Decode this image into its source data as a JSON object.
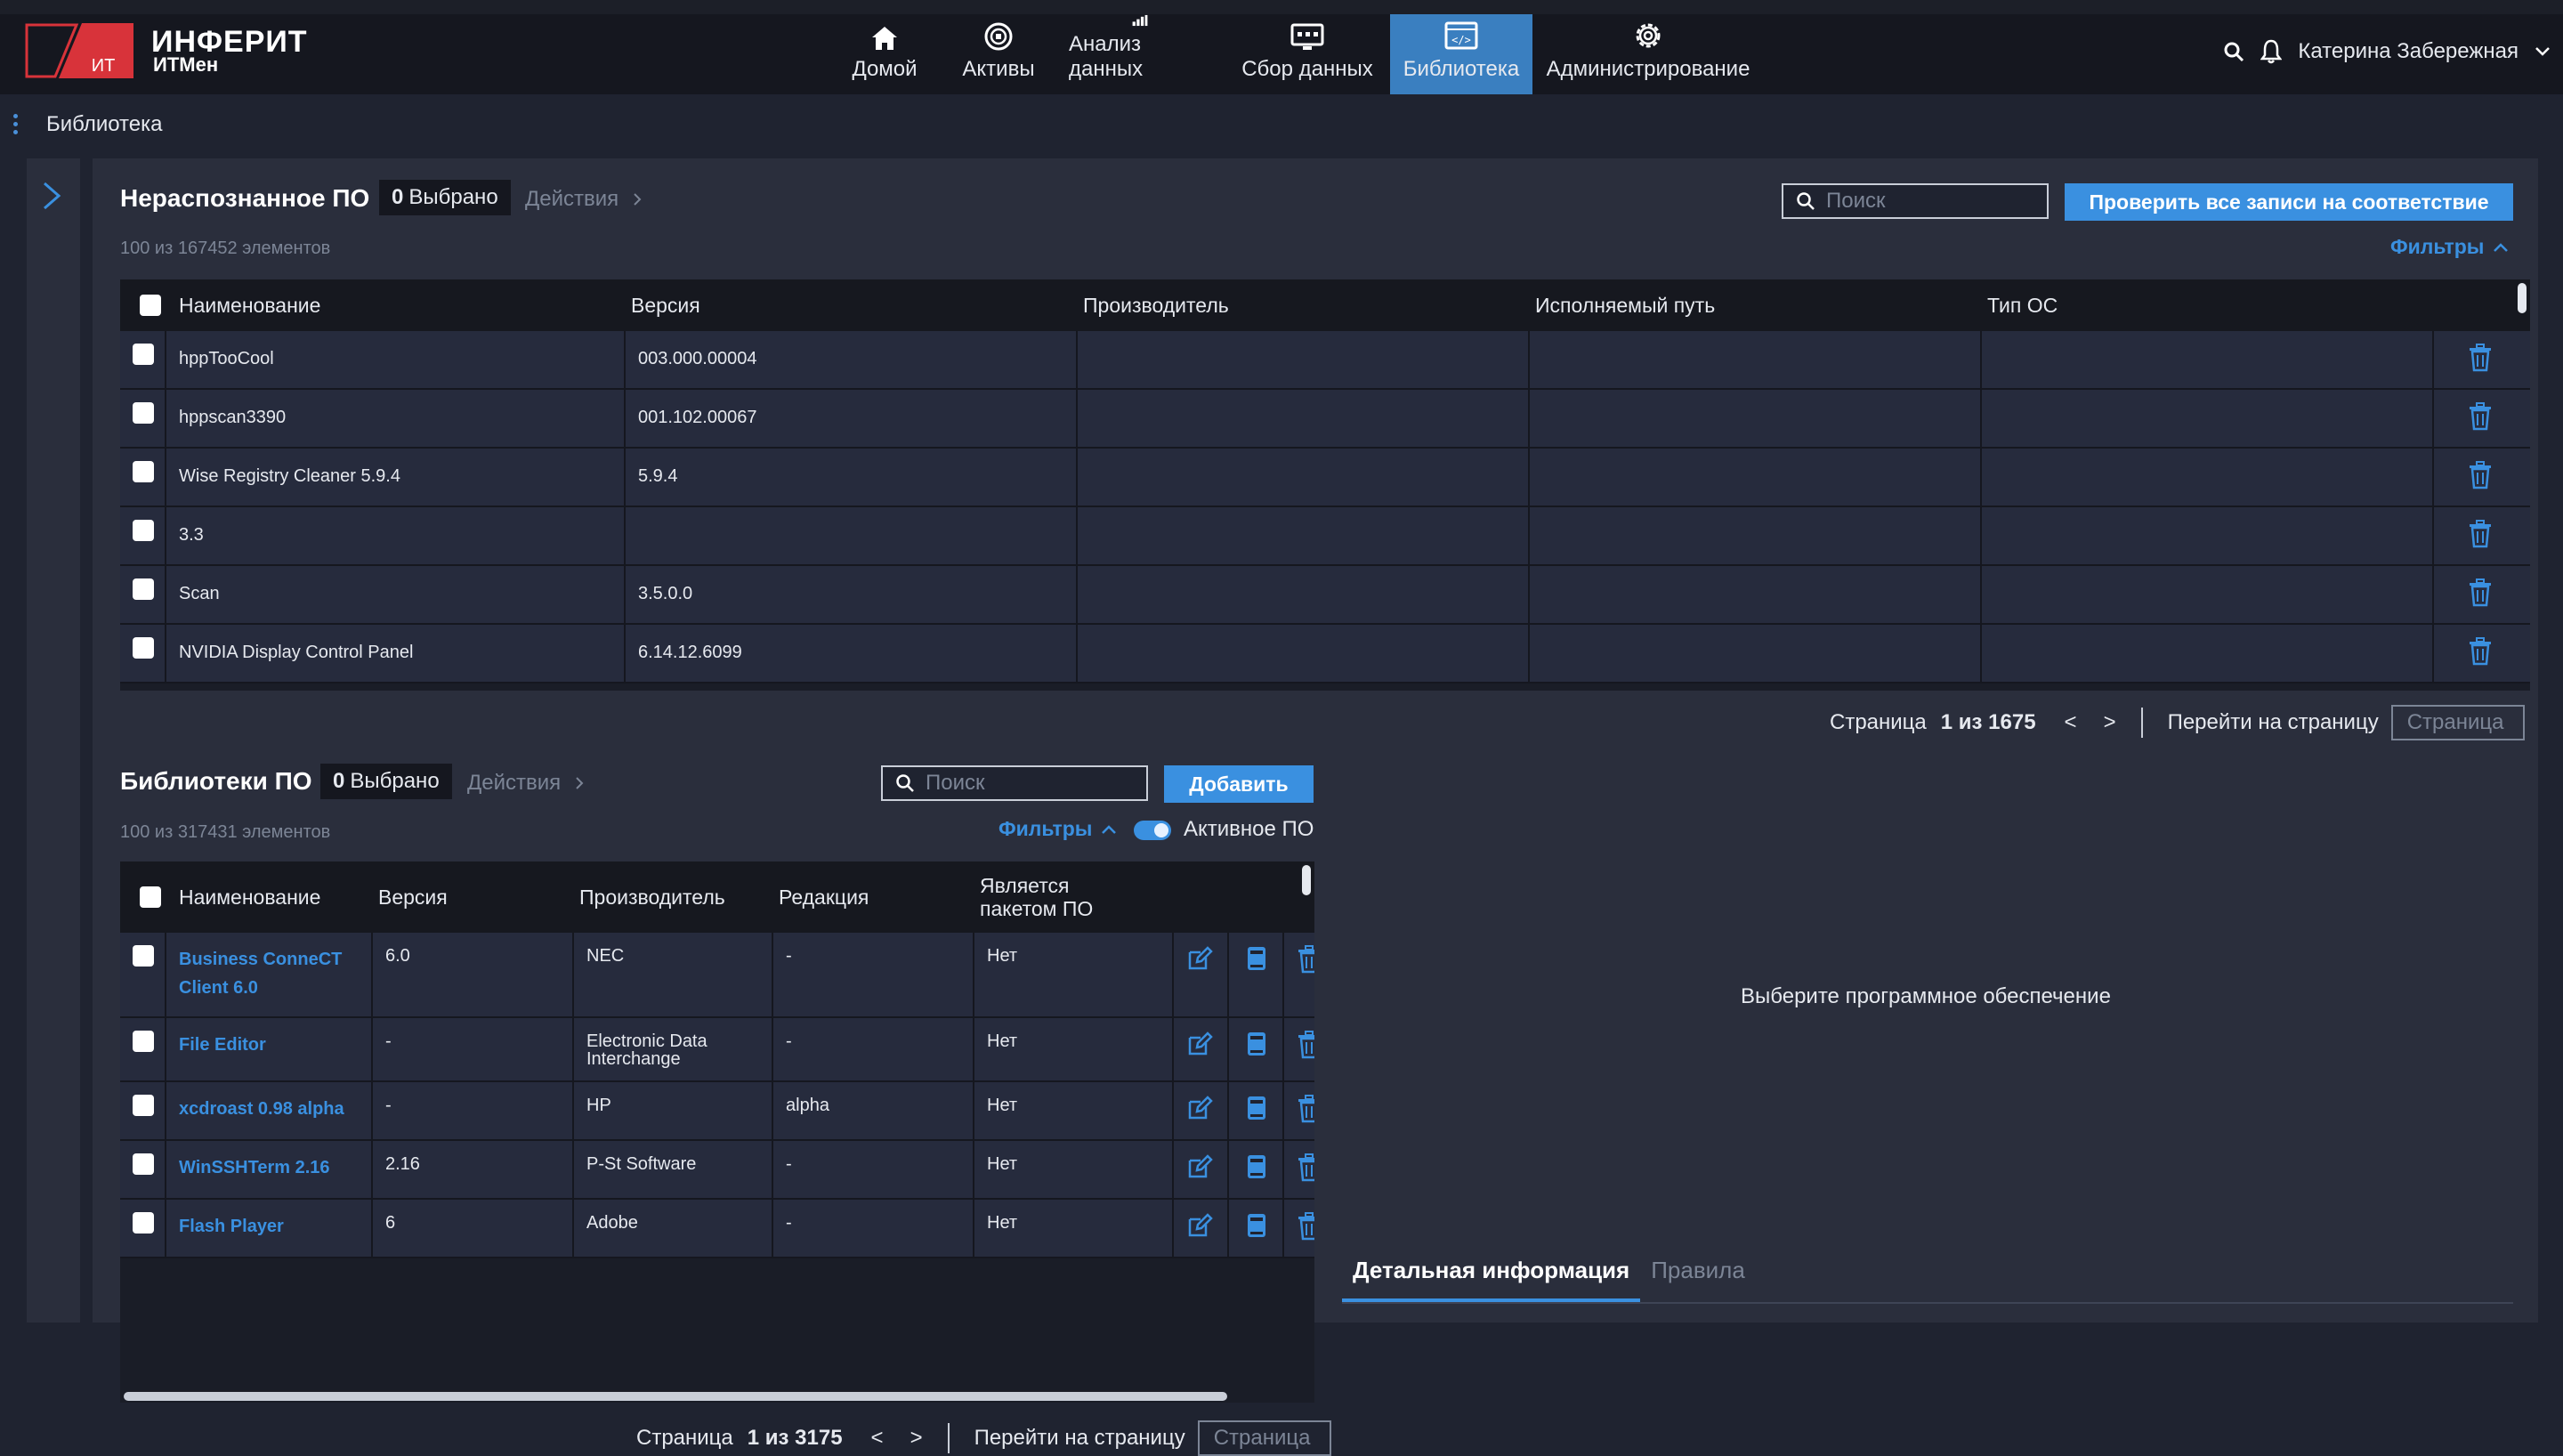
{
  "brand": {
    "name": "ИНФЕРИТ",
    "sub": "ИТМен",
    "logo_text": "ИТ"
  },
  "nav": [
    {
      "label": "Домой",
      "icon": "home-icon"
    },
    {
      "label": "Активы",
      "icon": "assets-icon"
    },
    {
      "label": "Анализ данных",
      "icon": "bar-chart-icon"
    },
    {
      "label": "Сбор данных",
      "icon": "data-collection-icon"
    },
    {
      "label": "Библиотека",
      "icon": "library-icon",
      "active": true
    },
    {
      "label": "Администрирование",
      "icon": "gear-icon"
    }
  ],
  "user": {
    "name": "Катерина Забережная"
  },
  "breadcrumb": "Библиотека",
  "unrecognized": {
    "title": "Нераспознанное ПО",
    "selected_count": "0",
    "selected_label": "Выбрано",
    "actions_label": "Действия",
    "count_text": "100 из 167452 элементов",
    "search_placeholder": "Поиск",
    "check_all_label": "Проверить все записи на соответствие",
    "filters_label": "Фильтры",
    "columns": [
      "Наименование",
      "Версия",
      "Производитель",
      "Исполняемый путь",
      "Тип ОС"
    ],
    "rows": [
      {
        "name": "hppTooCool",
        "version": "003.000.00004",
        "vendor": "",
        "path": "",
        "os": ""
      },
      {
        "name": "hppscan3390",
        "version": "001.102.00067",
        "vendor": "",
        "path": "",
        "os": ""
      },
      {
        "name": "Wise Registry Cleaner 5.9.4",
        "version": "5.9.4",
        "vendor": "",
        "path": "",
        "os": ""
      },
      {
        "name": "3.3",
        "version": "",
        "vendor": "",
        "path": "",
        "os": ""
      },
      {
        "name": "Scan",
        "version": "3.5.0.0",
        "vendor": "",
        "path": "",
        "os": ""
      },
      {
        "name": "NVIDIA Display Control Panel",
        "version": "6.14.12.6099",
        "vendor": "",
        "path": "",
        "os": ""
      }
    ],
    "pager": {
      "label": "Страница",
      "current": "1 из 1675",
      "prev": "<",
      "next": ">",
      "goto_label": "Перейти на страницу",
      "goto_placeholder": "Страница"
    }
  },
  "libraries": {
    "title": "Библиотеки ПО",
    "selected_count": "0",
    "selected_label": "Выбрано",
    "actions_label": "Действия",
    "count_text": "100 из 317431 элементов",
    "search_placeholder": "Поиск",
    "add_label": "Добавить",
    "filters_label": "Фильтры",
    "active_toggle_label": "Активное ПО",
    "columns": [
      "Наименование",
      "Версия",
      "Производитель",
      "Редакция",
      "Является пакетом ПО"
    ],
    "rows": [
      {
        "name": "Business ConneCT Client 6.0",
        "version": "6.0",
        "vendor": "NEC",
        "edition": "-",
        "is_package": "Нет"
      },
      {
        "name": "File Editor",
        "version": "-",
        "vendor": "Electronic Data Interchange",
        "edition": "-",
        "is_package": "Нет"
      },
      {
        "name": "xcdroast 0.98 alpha",
        "version": "-",
        "vendor": "HP",
        "edition": "alpha",
        "is_package": "Нет"
      },
      {
        "name": "WinSSHTerm 2.16",
        "version": "2.16",
        "vendor": "P-St Software",
        "edition": "-",
        "is_package": "Нет"
      },
      {
        "name": "Flash Player",
        "version": "6",
        "vendor": "Adobe",
        "edition": "-",
        "is_package": "Нет"
      }
    ],
    "pager": {
      "label": "Страница",
      "current": "1 из 3175",
      "prev": "<",
      "next": ">",
      "goto_label": "Перейти на страницу",
      "goto_placeholder": "Страница"
    }
  },
  "details": {
    "placeholder": "Выберите программное обеспечение",
    "tabs": [
      {
        "label": "Детальная информация",
        "active": true
      },
      {
        "label": "Правила",
        "active": false
      }
    ]
  },
  "colors": {
    "accent": "#3a90e0",
    "active_nav": "#3a7fc0",
    "logo_red": "#d8333a"
  }
}
